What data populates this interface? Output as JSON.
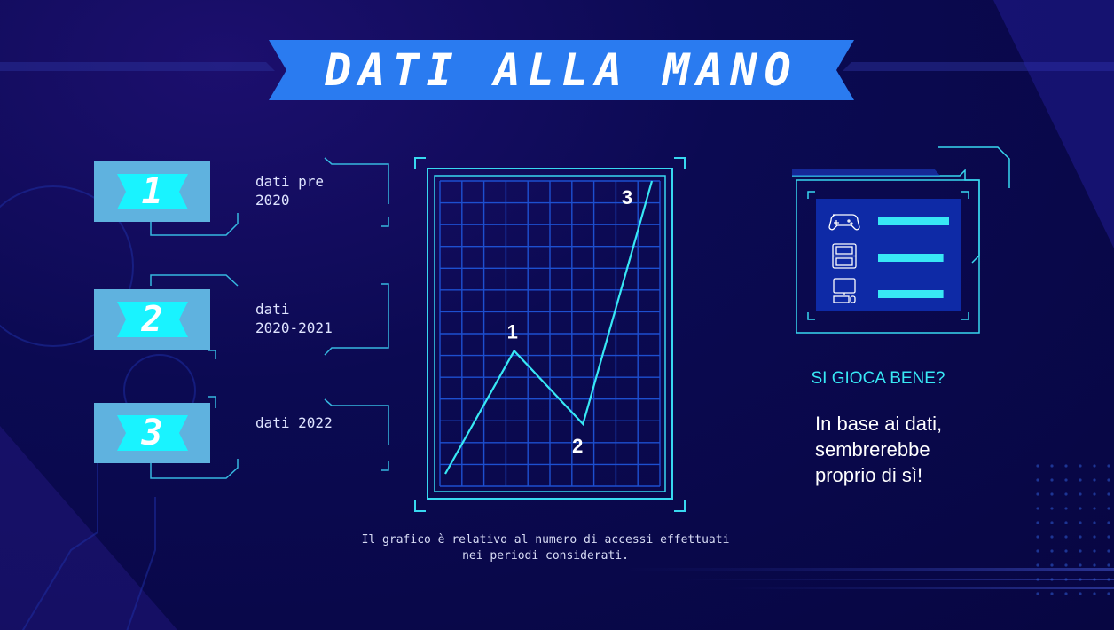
{
  "title": "DATI ALLA MANO",
  "periods": [
    {
      "badge": "1",
      "label": "dati pre\n2020"
    },
    {
      "badge": "2",
      "label": "dati\n2020-2021"
    },
    {
      "badge": "3",
      "label": "dati 2022"
    }
  ],
  "chart_data": {
    "type": "line",
    "title": "",
    "xlabel": "",
    "ylabel": "",
    "grid": true,
    "series": [
      {
        "points": [
          {
            "x": 0,
            "y": 0,
            "label": ""
          },
          {
            "x": 1,
            "y": 42,
            "label": "1"
          },
          {
            "x": 2,
            "y": 17,
            "label": "2"
          },
          {
            "x": 3,
            "y": 100,
            "label": "3"
          }
        ]
      }
    ]
  },
  "caption": "Il grafico è relativo al numero di accessi effettuati\nnei periodi considerati.",
  "device_panel": {
    "rows": [
      {
        "icon": "gamepad-icon",
        "fill": 1.0
      },
      {
        "icon": "handheld-console-icon",
        "fill": 0.92
      },
      {
        "icon": "computer-icon",
        "fill": 0.92
      }
    ]
  },
  "question": "SI GIOCA BENE?",
  "answer": "In base ai dati,\nsembrerebbe\nproprio di sì!",
  "colors": {
    "accent": "#38e8f5",
    "banner": "#2a7bf0",
    "badge": "#5fb2df",
    "line": "#38e8f5",
    "grid": "#1d4fd0"
  }
}
